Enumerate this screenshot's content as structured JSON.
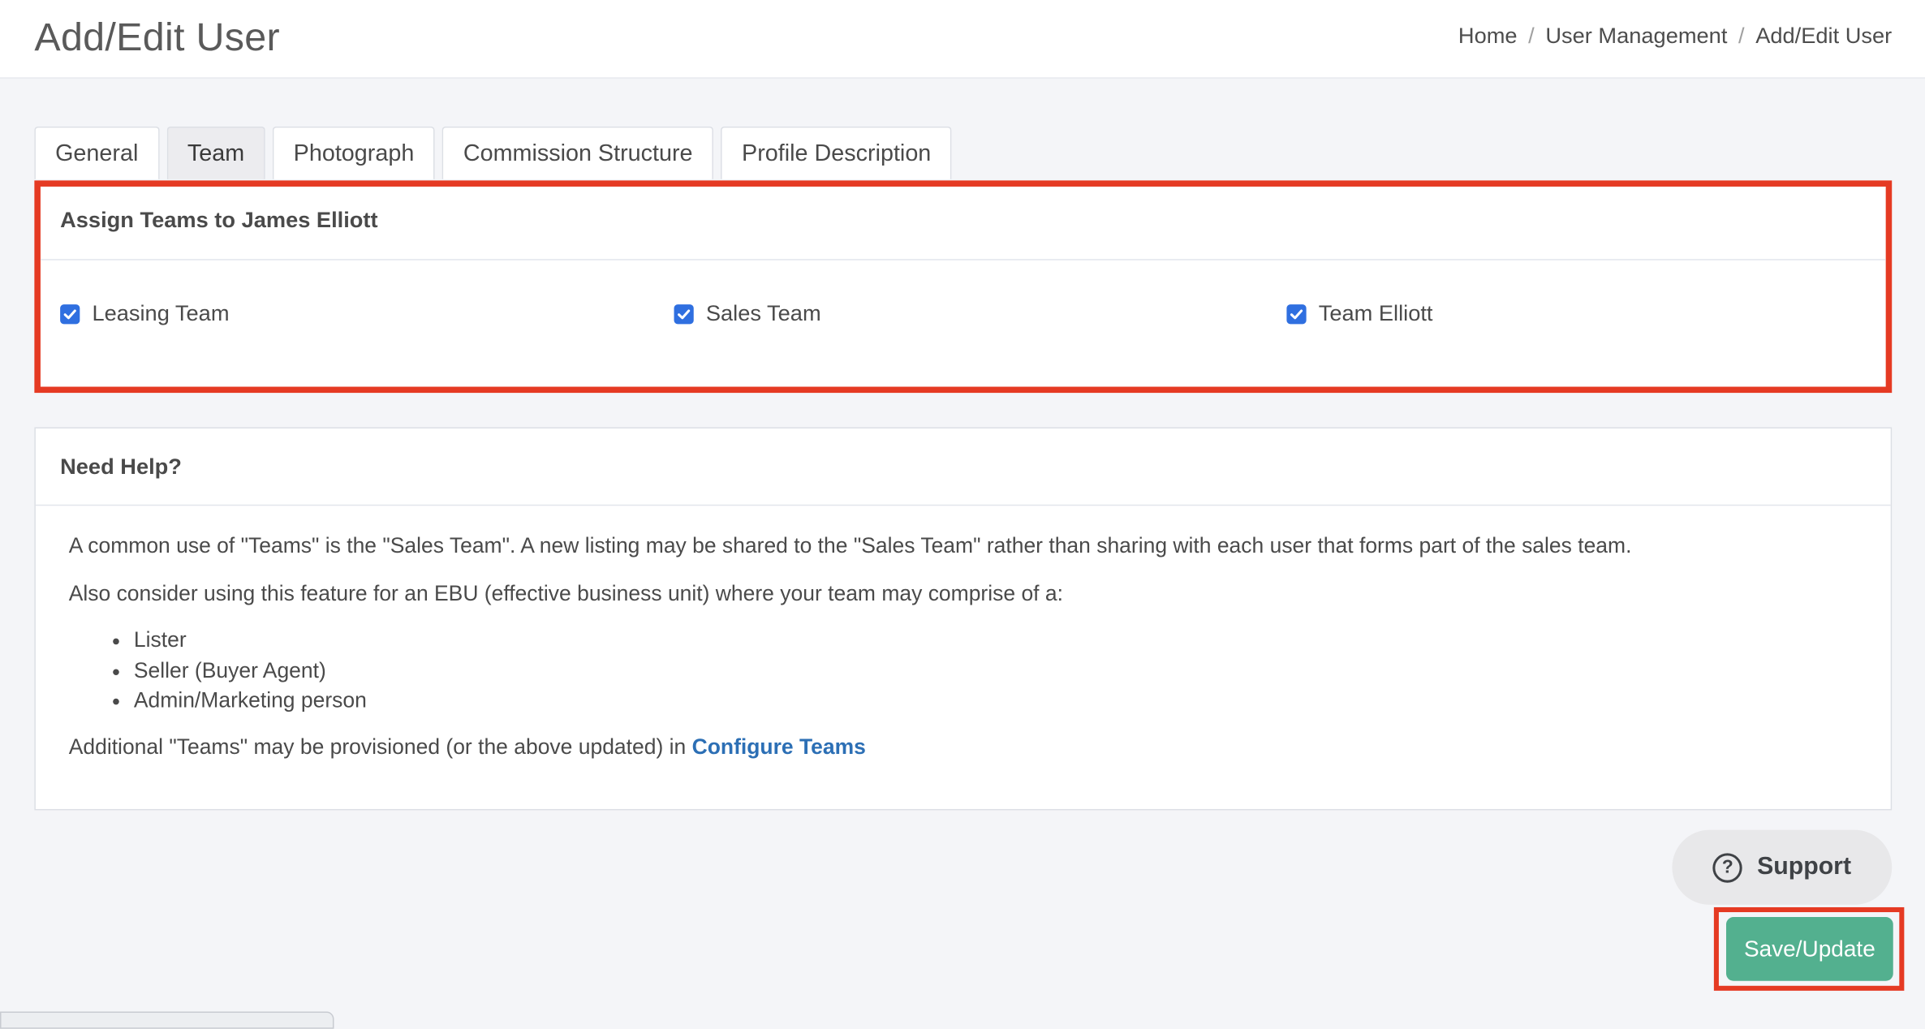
{
  "header": {
    "title": "Add/Edit User",
    "breadcrumb": [
      "Home",
      "User Management",
      "Add/Edit User"
    ]
  },
  "tabs": [
    {
      "label": "General",
      "active": false
    },
    {
      "label": "Team",
      "active": true
    },
    {
      "label": "Photograph",
      "active": false
    },
    {
      "label": "Commission Structure",
      "active": false
    },
    {
      "label": "Profile Description",
      "active": false
    }
  ],
  "assign": {
    "heading": "Assign Teams to James Elliott",
    "teams": [
      {
        "label": "Leasing Team",
        "checked": true
      },
      {
        "label": "Sales Team",
        "checked": true
      },
      {
        "label": "Team Elliott",
        "checked": true
      }
    ]
  },
  "help": {
    "heading": "Need Help?",
    "para1": "A common use of \"Teams\" is the \"Sales Team\". A new listing may be shared to the \"Sales Team\" rather than sharing with each user that forms part of the sales team.",
    "para2": "Also consider using this feature for an EBU (effective business unit) where your team may comprise of a:",
    "bullets": [
      "Lister",
      "Seller (Buyer Agent)",
      "Admin/Marketing person"
    ],
    "para3_prefix": "Additional \"Teams\" may be provisioned (or the above updated) in",
    "link": "Configure Teams"
  },
  "buttons": {
    "support": "Support",
    "save": "Save/Update"
  },
  "colors": {
    "highlight": "#e53a23",
    "save_button": "#53b08f",
    "link": "#2c6fb5",
    "checkbox": "#2f6fe0"
  }
}
